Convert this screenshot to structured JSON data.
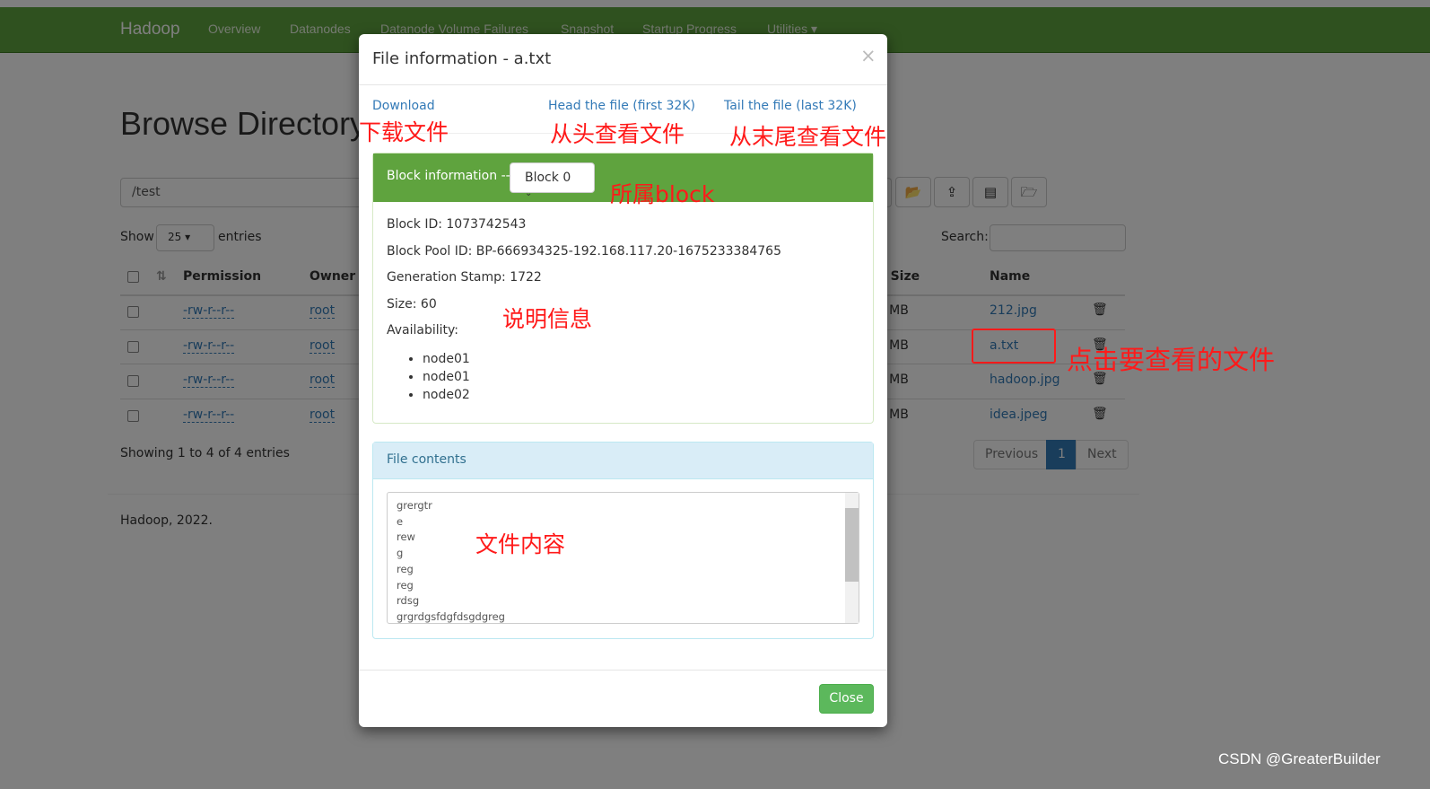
{
  "navbar": {
    "brand": "Hadoop",
    "items": [
      "Overview",
      "Datanodes",
      "Datanode Volume Failures",
      "Snapshot",
      "Startup Progress",
      "Utilities ▾"
    ]
  },
  "page": {
    "title": "Browse Directory",
    "path": "/test",
    "show_label": "Show",
    "entries_value": "25",
    "entries_label": "entries",
    "search_label": "Search:",
    "columns": [
      "Permission",
      "Owner",
      "Block Size",
      "Name"
    ],
    "rows": [
      {
        "permission": "-rw-r--r--",
        "owner": "root",
        "block_size": "128 MB",
        "name": "212.jpg"
      },
      {
        "permission": "-rw-r--r--",
        "owner": "root",
        "block_size": "128 MB",
        "name": "a.txt"
      },
      {
        "permission": "-rw-r--r--",
        "owner": "root",
        "block_size": "128 MB",
        "name": "hadoop.jpg"
      },
      {
        "permission": "-rw-r--r--",
        "owner": "root",
        "block_size": "128 MB",
        "name": "idea.jpeg"
      }
    ],
    "showing": "Showing 1 to 4 of 4 entries",
    "prev": "Previous",
    "page_num": "1",
    "next": "Next",
    "footer": "Hadoop, 2022."
  },
  "modal": {
    "title": "File information - a.txt",
    "close_x": "×",
    "download": "Download",
    "head": "Head the file (first 32K)",
    "tail": "Tail the file (last 32K)",
    "block_heading": "Block information --",
    "block_select": "Block 0",
    "block_id": "Block ID: 1073742543",
    "pool_id": "Block Pool ID: BP-666934325-192.168.117.20-1675233384765",
    "gen_stamp": "Generation Stamp: 1722",
    "size": "Size: 60",
    "availability": "Availability:",
    "nodes": [
      "node01",
      "node01",
      "node02"
    ],
    "contents_heading": "File contents",
    "contents": "grergtr\ne\nrew\ng\nreg\nreg\nrdsg\ngrgrdgsfdgfdsgdgreg",
    "close": "Close"
  },
  "annotations": {
    "download": "下载文件",
    "head": "从头查看文件",
    "tail": "从末尾查看文件",
    "block": "所属block",
    "info": "说明信息",
    "contents": "文件内容",
    "click": "点击要查看的文件"
  },
  "watermark": "CSDN @GreaterBuilder",
  "colors": {
    "navbar": "#5fa33e",
    "panel_heading": "#5fa33e",
    "close_button": "#5cb85c",
    "info_heading": "#d9edf7",
    "annotation": "#ff1a1a"
  }
}
